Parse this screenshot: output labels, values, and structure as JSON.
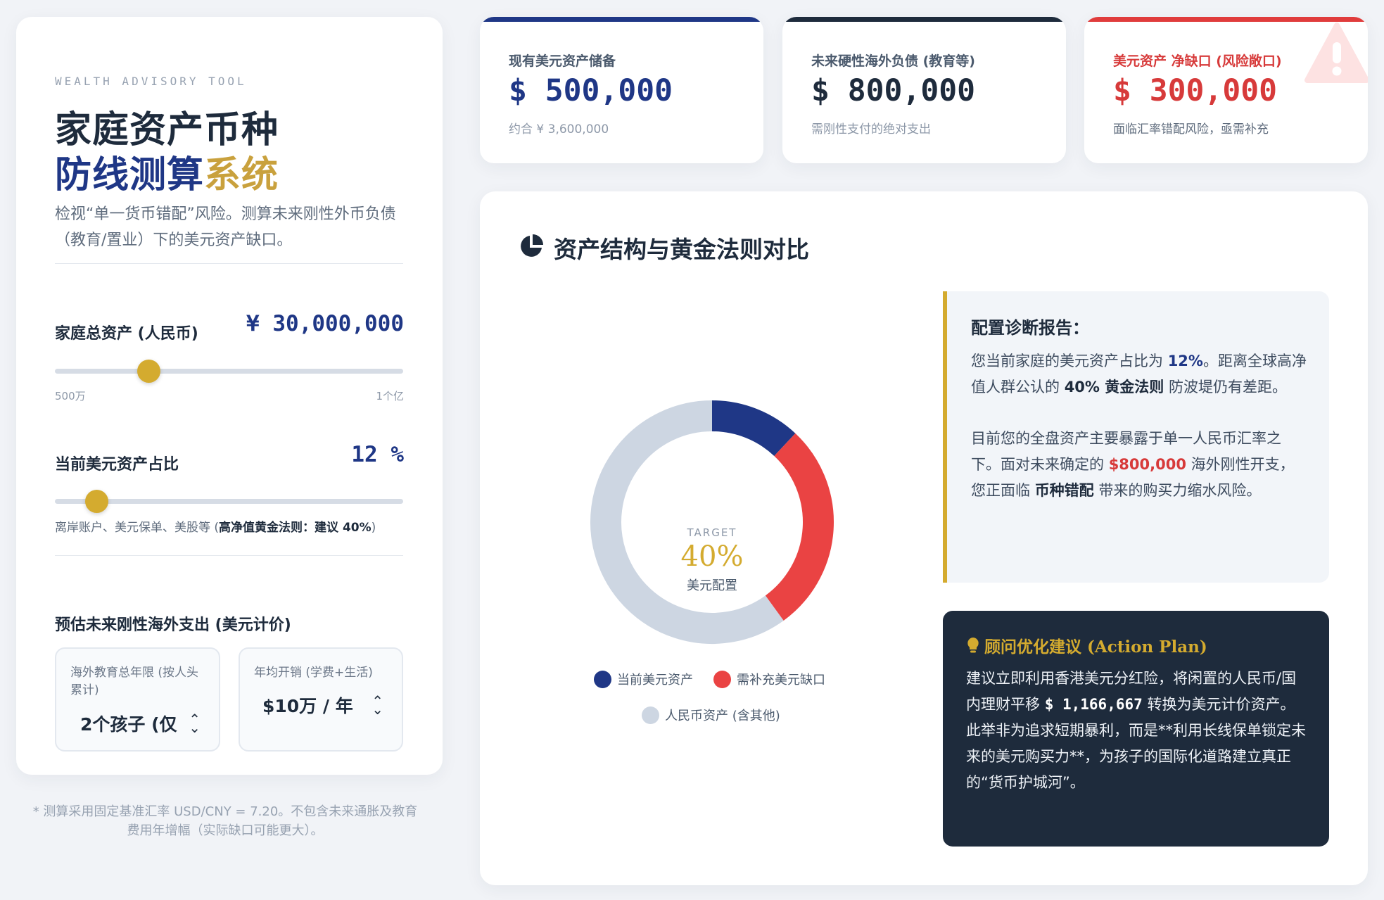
{
  "left": {
    "eyebrow": "WEALTH ADVISORY TOOL",
    "title_line1": "家庭资产币种",
    "title_line2_a": "防线测算",
    "title_line2_b": "系统",
    "subtitle": "检视“单一货币错配”风险。测算未来刚性外币负债（教育/置业）下的美元资产缺口。",
    "total_assets": {
      "label": "家庭总资产 (人民币)",
      "value": "¥ 30,000,000",
      "min_label": "500万",
      "max_label": "1个亿",
      "slider_fraction": 0.27
    },
    "usd_ratio": {
      "label": "当前美元资产占比",
      "value": "12 %",
      "slider_fraction": 0.12,
      "hint_prefix": "离岸账户、美元保单、美股等 (",
      "hint_bold": "高净值黄金法则：建议 40%",
      "hint_suffix": ")"
    },
    "expense_section": {
      "label": "预估未来刚性海外支出 (美元计价)",
      "select1_caption": "海外教育总年限 (按人头累计)",
      "select1_value": "2个孩子 (仅",
      "select2_caption": "年均开销 (学费+生活)",
      "select2_value": "$10万 / 年"
    },
    "footnote": "* 测算采用固定基准汇率 USD/CNY = 7.20。不包含未来通胀及教育费用年增幅（实际缺口可能更大）。"
  },
  "cards": [
    {
      "label": "现有美元资产储备",
      "value": "$ 500,000",
      "note": "约合 ¥ 3,600,000",
      "accent": "#1f3786"
    },
    {
      "label": "未来硬性海外负债 (教育等)",
      "value": "$ 800,000",
      "note": "需刚性支付的绝对支出",
      "accent": "#1e2b3c"
    },
    {
      "label": "美元资产 净缺口 (风险敞口)",
      "value": "$ 300,000",
      "note": "面临汇率错配风险，亟需补充",
      "accent": "#e03c3c"
    }
  ],
  "main": {
    "section_title": "资产结构与黄金法则对比",
    "donut_center": {
      "eyebrow": "TARGET",
      "value": "40%",
      "caption": "美元配置"
    },
    "legend": [
      "当前美元资产",
      "需补充美元缺口",
      "人民币资产 (含其他)"
    ],
    "diagnosis": {
      "title": "配置诊断报告：",
      "p1_a": "您当前家庭的美元资产占比为 ",
      "p1_b": "12%",
      "p1_c": "。距离全球高净值人群公认的 ",
      "p1_d": "40% 黄金法则",
      "p1_e": " 防波堤仍有差距。",
      "p2_a": "目前您的全盘资产主要暴露于单一人民币汇率之下。面对未来确定的 ",
      "p2_b": "$800,000",
      "p2_c": " 海外刚性开支，您正面临 ",
      "p2_d": "币种错配",
      "p2_e": " 带来的购买力缩水风险。"
    },
    "action": {
      "title": "顾问优化建议 (Action Plan)",
      "p1_a": "建议立即利用香港美元分红险，将闲置的人民币/国内理财平移 ",
      "p1_b": "$ 1,166,667",
      "p1_c": " 转换为美元计价资产。",
      "p2": "此举非为追求短期暴利，而是**利用长线保单锁定未来的美元购买力**，为孩子的国际化道路建立真正的“货币护城河”。"
    }
  },
  "chart_data": {
    "type": "pie",
    "donut": true,
    "categories": [
      "当前美元资产",
      "需补充美元缺口",
      "人民币资产 (含其他)"
    ],
    "values": [
      12,
      28,
      60
    ],
    "colors": [
      "#1f3786",
      "#ea4343",
      "#cdd6e2"
    ]
  },
  "colors": {
    "navy": "#1f3786",
    "gold": "#d4ab2f",
    "red": "#e03c3c",
    "dark": "#1e2b3c"
  }
}
